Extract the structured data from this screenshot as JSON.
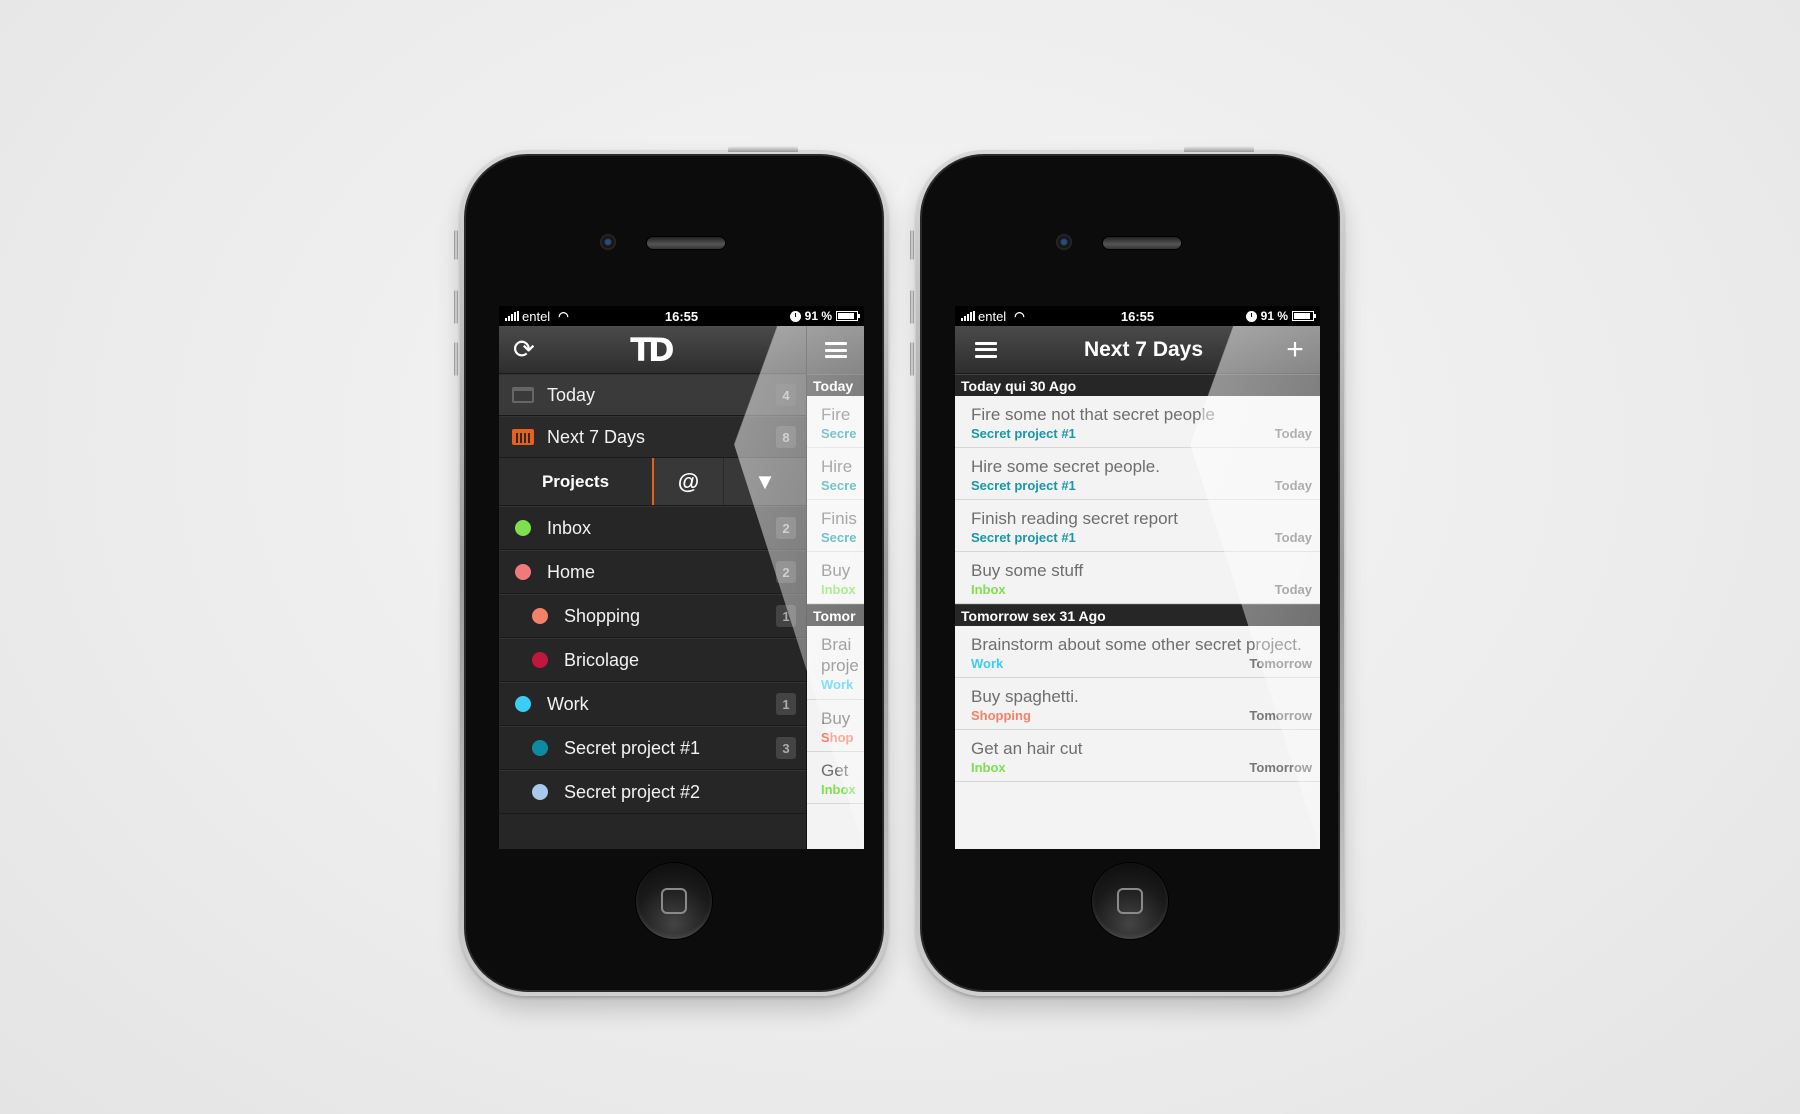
{
  "status_bar": {
    "carrier": "entel",
    "time": "16:55",
    "battery": "91 %",
    "battery_level": 0.91
  },
  "left_screen": {
    "nav": {
      "sync_icon": "sync-icon",
      "logo": "TD",
      "menu_icon": "hamburger-icon"
    },
    "filters": [
      {
        "label": "Today",
        "count": "4",
        "icon": "calendar-icon"
      },
      {
        "label": "Next 7 Days",
        "count": "8",
        "icon": "calendar-week-icon"
      }
    ],
    "tabs": {
      "projects": "Projects",
      "contexts": "@",
      "filter": "▼"
    },
    "projects": [
      {
        "label": "Inbox",
        "count": "2",
        "color": "#7ee050",
        "level": 0
      },
      {
        "label": "Home",
        "count": "2",
        "color": "#f07a7a",
        "level": 0
      },
      {
        "label": "Shopping",
        "count": "1",
        "color": "#f5806a",
        "level": 1
      },
      {
        "label": "Bricolage",
        "count": "",
        "color": "#c0173e",
        "level": 1
      },
      {
        "label": "Work",
        "count": "1",
        "color": "#3ccdf5",
        "level": 0
      },
      {
        "label": "Secret project #1",
        "count": "3",
        "color": "#0f8aa0",
        "level": 1
      },
      {
        "label": "Secret project #2",
        "count": "",
        "color": "#a8c8ec",
        "level": 1
      }
    ],
    "peek": {
      "sections": [
        {
          "header": "Today",
          "tasks": [
            {
              "title": "Fire",
              "project": "Secre",
              "color": "#1a97a8"
            },
            {
              "title": "Hire",
              "project": "Secre",
              "color": "#1a97a8"
            },
            {
              "title": "Finis",
              "project": "Secre",
              "color": "#1a97a8"
            },
            {
              "title": "Buy",
              "project": "Inbox",
              "color": "#7ee050"
            }
          ]
        },
        {
          "header": "Tomor",
          "tasks": [
            {
              "title": "Brai",
              "title2": "proje",
              "project": "Work",
              "color": "#3ccdf5"
            },
            {
              "title": "Buy",
              "project": "Shop",
              "color": "#f5806a"
            },
            {
              "title": "Get",
              "project": "Inbox",
              "color": "#7ee050"
            }
          ]
        }
      ]
    }
  },
  "right_screen": {
    "nav": {
      "title": "Next 7 Days",
      "menu_icon": "hamburger-icon",
      "add_icon": "+"
    },
    "sections": [
      {
        "header": "Today qui 30 Ago",
        "tasks": [
          {
            "title": "Fire some not that secret people",
            "project": "Secret project #1",
            "project_color": "#1a97a8",
            "date": "Today"
          },
          {
            "title": "Hire some secret people.",
            "project": "Secret project #1",
            "project_color": "#1a97a8",
            "date": "Today"
          },
          {
            "title": "Finish reading secret report",
            "project": "Secret project #1",
            "project_color": "#1a97a8",
            "date": "Today"
          },
          {
            "title": "Buy some stuff",
            "project": "Inbox",
            "project_color": "#7ee050",
            "date": "Today"
          }
        ]
      },
      {
        "header": "Tomorrow sex 31 Ago",
        "tasks": [
          {
            "title": "Brainstorm about some other secret project.",
            "project": "Work",
            "project_color": "#3ccdf5",
            "date": "Tomorrow"
          },
          {
            "title": "Buy spaghetti.",
            "project": "Shopping",
            "project_color": "#f5806a",
            "date": "Tomorrow"
          },
          {
            "title": "Get an hair cut",
            "project": "Inbox",
            "project_color": "#7ee050",
            "date": "Tomorrow"
          }
        ]
      }
    ]
  },
  "colors": {
    "accent": "#e8611a",
    "background": "#ececec"
  }
}
